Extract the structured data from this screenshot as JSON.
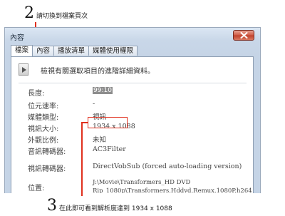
{
  "callouts": {
    "step2": {
      "number": "2",
      "text": "請切換到檔案頁次"
    },
    "step3": {
      "number": "3",
      "text": "在此即可看到解析度達到 1934 x 1088"
    }
  },
  "dialog": {
    "title": "內容",
    "close_icon": "close-x-icon",
    "tabs": [
      "檔案",
      "內容",
      "播放清單",
      "媒體使用權限"
    ],
    "active_tab": "檔案",
    "description": "檢視有關選取項目的進階詳細資料。",
    "properties": [
      {
        "label": "長度:",
        "value": "99:10"
      },
      {
        "label": "位元速率:",
        "value": "-"
      },
      {
        "label": "媒體類型:",
        "value": "視訊"
      },
      {
        "label": "視訊大小:",
        "value": "1934 x 1088"
      },
      {
        "label": "外觀比例:",
        "value": "未知"
      },
      {
        "label": "音訊轉碼器:",
        "value": "AC3Filter"
      },
      {
        "label": "視訊轉碼器:",
        "value": "DirectVobSub (forced auto-loading version)"
      },
      {
        "label": "位置:",
        "value_lines": [
          "J:\\Movie\\Transformers_HD DVD",
          "Rip_1080p\\Transformers.Hddvd.Remux.1080P.h264"
        ]
      }
    ]
  },
  "colors": {
    "highlight": "#e0301e",
    "selection": "#8d8d8d"
  }
}
